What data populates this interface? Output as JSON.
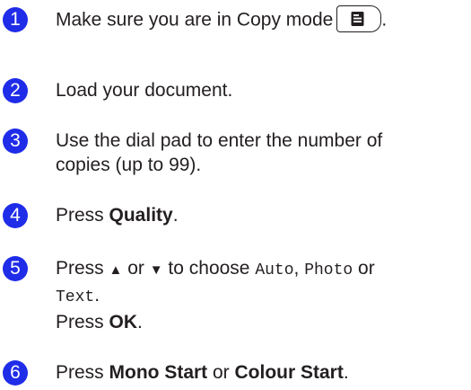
{
  "steps": [
    {
      "number": "1",
      "parts": [
        "Make sure you are in Copy mode",
        "."
      ]
    },
    {
      "number": "2",
      "text": "Load your document."
    },
    {
      "number": "3",
      "line1": "Use the dial pad to enter the number of",
      "line2": "copies (up to 99)."
    },
    {
      "number": "4",
      "prefix": "Press ",
      "bold": "Quality",
      "suffix": "."
    },
    {
      "number": "5",
      "press": "Press ",
      "up_arrow": "▲",
      "or1": " or ",
      "down_arrow": "▼",
      "to_choose": " to choose ",
      "opt_auto": "Auto",
      "comma": ", ",
      "opt_photo": "Photo",
      "or2": " or",
      "opt_text": "Text",
      "period": ".",
      "press2": "Press ",
      "ok": "OK",
      "period2": "."
    },
    {
      "number": "6",
      "press": "Press ",
      "mono_start": "Mono Start",
      "or": " or ",
      "colour_start": "Colour Start",
      "period": "."
    }
  ],
  "icons": {
    "copy_mode_key": "copy-mode-key-icon"
  },
  "colors": {
    "step_circle": "#1f2ce8",
    "text": "#231f20"
  }
}
